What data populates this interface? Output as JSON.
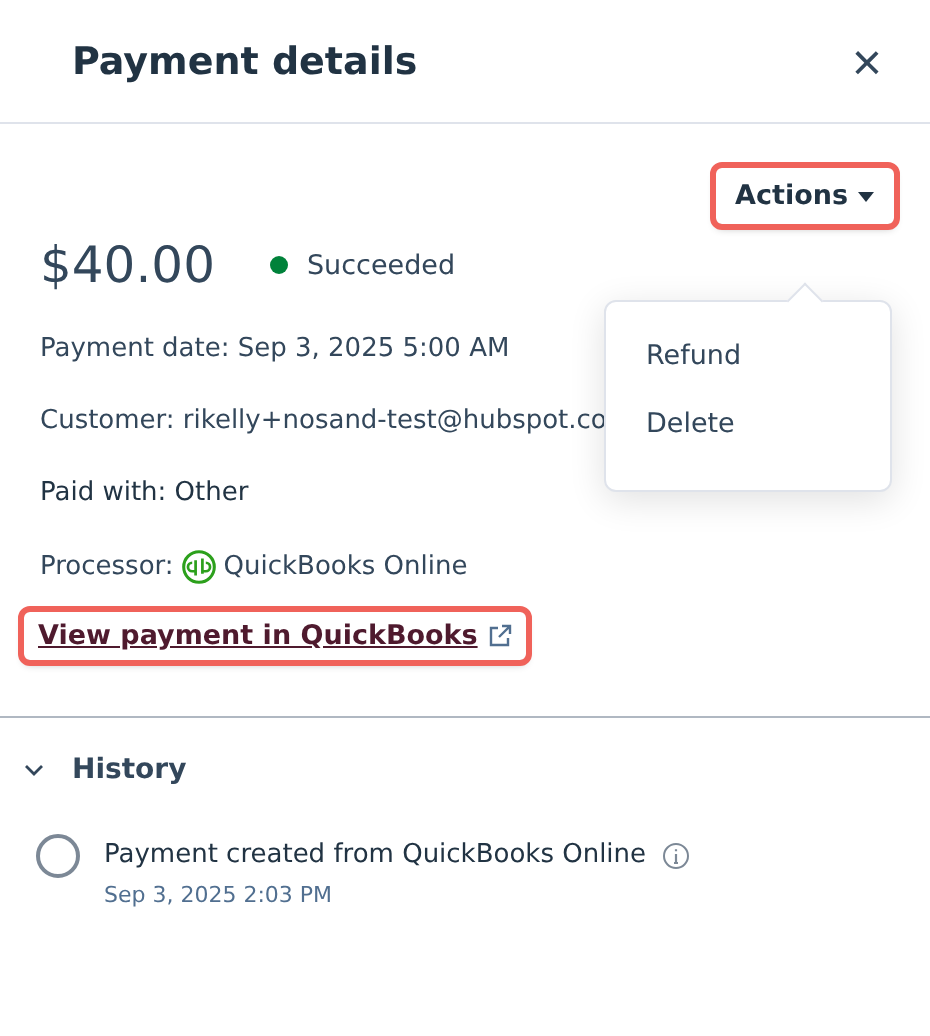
{
  "panel": {
    "title": "Payment details",
    "close": "×"
  },
  "actions": {
    "label": "Actions",
    "expanded": true,
    "menu": [
      {
        "label": "Refund"
      },
      {
        "label": "Delete"
      }
    ]
  },
  "amount": "$40.00",
  "status": {
    "label": "Succeeded",
    "color": "#00823a"
  },
  "details": [
    {
      "kind": "text",
      "text": "Payment date: Sep 3, 2025 5:00 AM"
    },
    {
      "kind": "text",
      "text": "Customer: rikelly+nosand-test@hubspot.co"
    },
    {
      "kind": "dark",
      "text": "Paid with: Other"
    },
    {
      "kind": "processor",
      "label": "Processor:",
      "value": "QuickBooks Online"
    }
  ],
  "link": "View payment in QuickBooks",
  "history": {
    "title": "History",
    "expanded": true,
    "events": [
      {
        "text": "Payment created from QuickBooks Online",
        "time": "Sep 3, 2025 2:03 PM"
      }
    ]
  }
}
